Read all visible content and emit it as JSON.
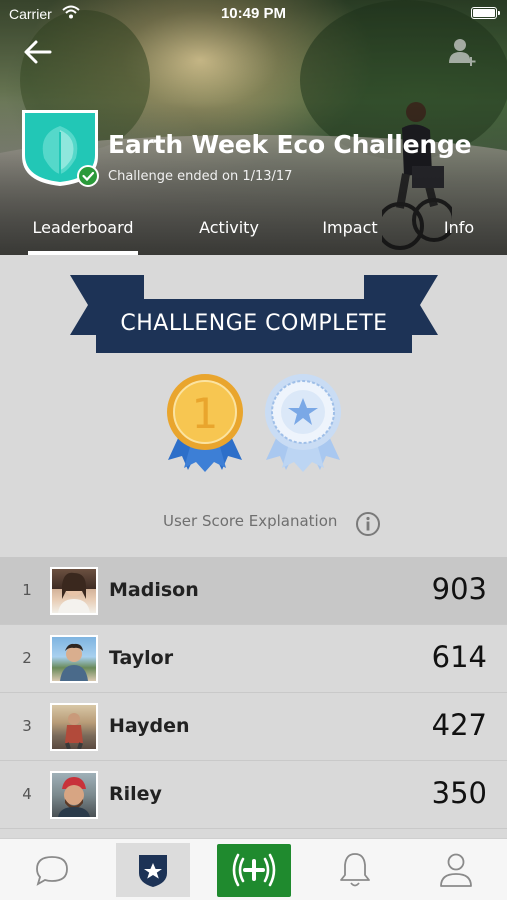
{
  "status_bar": {
    "carrier": "Carrier",
    "time": "10:49 PM"
  },
  "header": {
    "title": "Earth Week Eco Challenge",
    "subtitle": "Challenge ended on 1/13/17"
  },
  "tabs": [
    {
      "label": "Leaderboard",
      "active": true
    },
    {
      "label": "Activity",
      "active": false
    },
    {
      "label": "Impact",
      "active": false
    },
    {
      "label": "Info",
      "active": false
    }
  ],
  "banner": {
    "text": "CHALLENGE COMPLETE"
  },
  "medals": {
    "first_place_number": "1"
  },
  "score_explanation": "User Score Explanation",
  "leaderboard": [
    {
      "rank": "1",
      "name": "Madison",
      "score": "903"
    },
    {
      "rank": "2",
      "name": "Taylor",
      "score": "614"
    },
    {
      "rank": "3",
      "name": "Hayden",
      "score": "427"
    },
    {
      "rank": "4",
      "name": "Riley",
      "score": "350"
    }
  ],
  "bottom_tabs": [
    "chat-icon",
    "badge-icon",
    "log-action-icon",
    "bell-icon",
    "profile-icon"
  ],
  "colors": {
    "accent_teal": "#22c7b6",
    "banner_navy": "#1d3356",
    "gold": "#f2b43a",
    "medal_blue": "#3d7fd6",
    "fab_green": "#1f8a2e"
  }
}
